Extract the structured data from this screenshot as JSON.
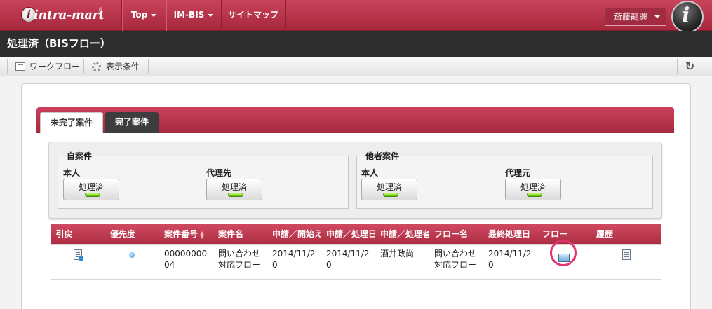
{
  "nav": {
    "logo_text": "intra-mart",
    "logo_reg": "®",
    "items": [
      {
        "label": "Top",
        "has_caret": true
      },
      {
        "label": "IM-BIS",
        "has_caret": true
      },
      {
        "label": "サイトマップ",
        "has_caret": false
      }
    ],
    "user_name": "斎藤龍興",
    "avatar_icon": "intra-mart-i-icon"
  },
  "page_title": "処理済（BISフロー）",
  "toolbar": {
    "items": [
      {
        "label": "ワークフロー",
        "icon": "workflow-icon"
      },
      {
        "label": "表示条件",
        "icon": "gear-icon"
      }
    ],
    "refresh_icon": "refresh-icon"
  },
  "tabs": [
    {
      "label": "未完了案件",
      "active": true
    },
    {
      "label": "完了案件",
      "active": false
    }
  ],
  "filters": {
    "groups": [
      {
        "legend": "自案件",
        "subs": [
          {
            "label": "本人",
            "button": "処理済"
          },
          {
            "label": "代理先",
            "button": "処理済"
          }
        ]
      },
      {
        "legend": "他者案件",
        "subs": [
          {
            "label": "本人",
            "button": "処理済"
          },
          {
            "label": "代理元",
            "button": "処理済"
          }
        ]
      }
    ]
  },
  "table": {
    "columns": [
      "引戻",
      "優先度",
      "案件番号",
      "案件名",
      "申請／開始え",
      "申請／処理日",
      "申請／処理者",
      "フロー名",
      "最終処理日",
      "フロー",
      "履歴"
    ],
    "rows": [
      {
        "case_number": "0000000004",
        "case_name": "問い合わせ対応フロー",
        "applied_date": "2014/11/20",
        "processed_date": "2014/11/20",
        "processor": "酒井政尚",
        "flow_name": "問い合わせ対応フロー",
        "last_processed": "2014/11/20"
      }
    ]
  },
  "colors": {
    "brand_red": "#b8324a",
    "title_bar": "#2e2e2e",
    "highlight_ring": "#e0336f"
  }
}
